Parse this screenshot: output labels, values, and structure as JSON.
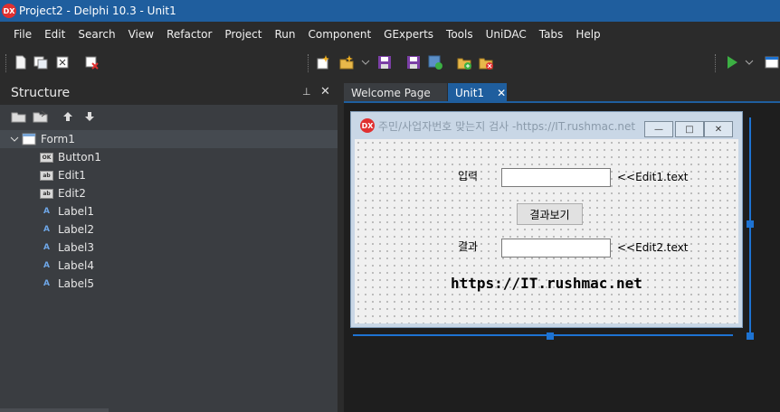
{
  "window": {
    "title": "Project2 - Delphi 10.3 - Unit1",
    "logo": "DX"
  },
  "menu": [
    "File",
    "Edit",
    "Search",
    "View",
    "Refactor",
    "Project",
    "Run",
    "Component",
    "GExperts",
    "Tools",
    "UniDAC",
    "Tabs",
    "Help"
  ],
  "toolbar_icons": [
    "new-file-icon",
    "open-icon",
    "save-all-icon",
    "close-icon",
    "new-item-icon",
    "open-project-icon",
    "save-icon",
    "save-project-icon",
    "save-as-icon",
    "add-file-icon",
    "remove-file-icon",
    "run-icon",
    "run-dropdown-icon",
    "more-icon"
  ],
  "structure": {
    "title": "Structure",
    "pin_glyph": "⊥",
    "close_glyph": "✕",
    "tree": {
      "root": "Form1",
      "children": [
        {
          "label": "Button1",
          "icon": "OK"
        },
        {
          "label": "Edit1",
          "icon": "ab"
        },
        {
          "label": "Edit2",
          "icon": "ab"
        },
        {
          "label": "Label1",
          "icon": "A"
        },
        {
          "label": "Label2",
          "icon": "A"
        },
        {
          "label": "Label3",
          "icon": "A"
        },
        {
          "label": "Label4",
          "icon": "A"
        },
        {
          "label": "Label5",
          "icon": "A"
        }
      ]
    }
  },
  "tabs": [
    {
      "label": "Welcome Page",
      "active": false
    },
    {
      "label": "Unit1",
      "active": true,
      "close": "✕"
    }
  ],
  "form": {
    "logo": "DX",
    "caption": "주민/사업자번호 맞는지 검사 -https://IT.rushmac.net",
    "minimize_glyph": "—",
    "maximize_glyph": "□",
    "close_glyph": "✕",
    "label_input": "입력",
    "edit1_hint": "<<Edit1.text",
    "button": "결과보기",
    "label_result": "결과",
    "edit2_hint": "<<Edit2.text",
    "url": "https://IT.rushmac.net"
  },
  "colors": {
    "accent": "#1e73d2",
    "titlebar": "#1f5e9e",
    "run": "#3cb043"
  }
}
